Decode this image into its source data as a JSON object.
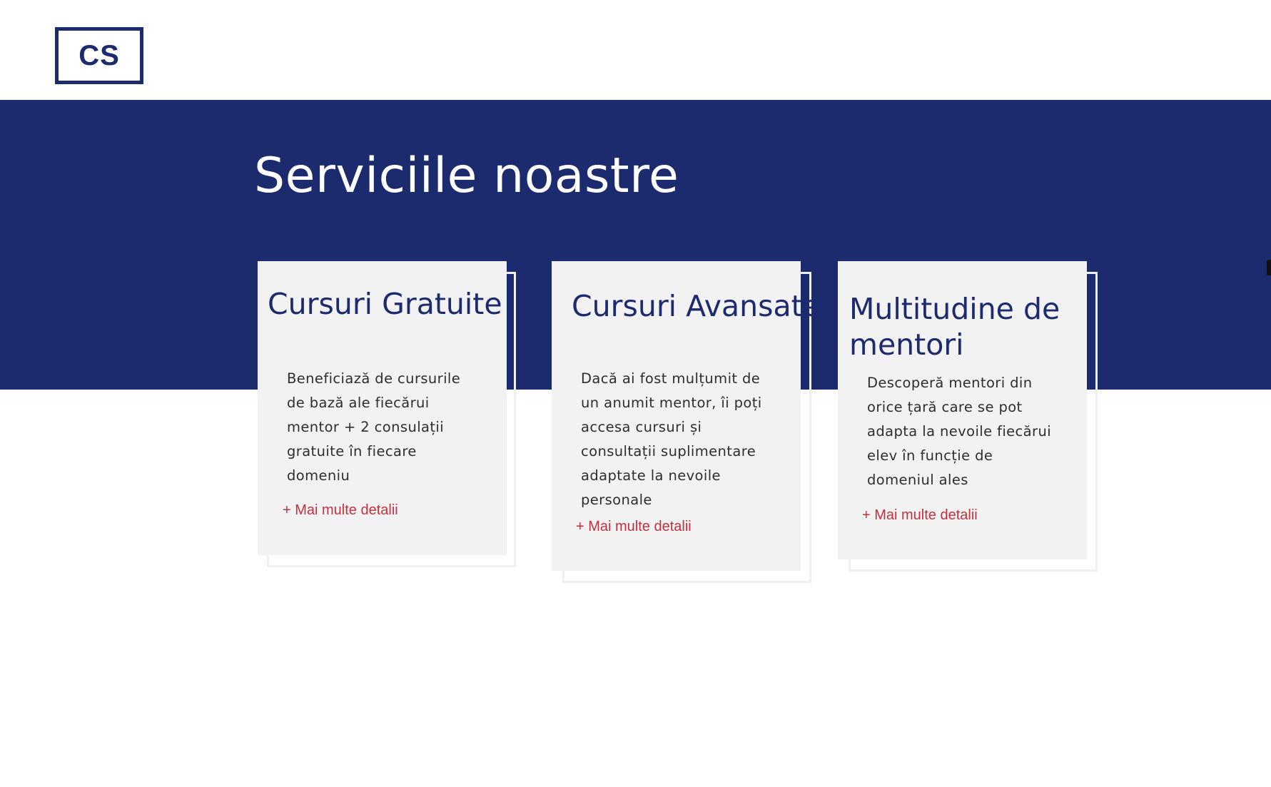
{
  "header": {
    "logo_text": "CS"
  },
  "section": {
    "title": "Serviciile noastre"
  },
  "cards": [
    {
      "title": "Cursuri Gratuite",
      "text": "Beneficiază de cursurile de bază ale fiecărui mentor + 2 consulații gratuite în fiecare domeniu",
      "link": "+ Mai multe detalii"
    },
    {
      "title": "Cursuri Avansate",
      "text": "Dacă ai fost mulțumit de un anumit mentor, îi poți accesa cursuri și consultații suplimentare adaptate la nevoile personale",
      "link": "+ Mai multe detalii"
    },
    {
      "title": "Multitudine de mentori",
      "text": "Descoperă mentori din orice țară care se pot adapta la nevoile fiecărui elev în funcție de domeniul ales",
      "link": "+ Mai multe detalii"
    }
  ],
  "colors": {
    "brand_navy": "#1c2a6e",
    "link_red": "#c3303f",
    "card_bg": "#f2f2f2"
  }
}
